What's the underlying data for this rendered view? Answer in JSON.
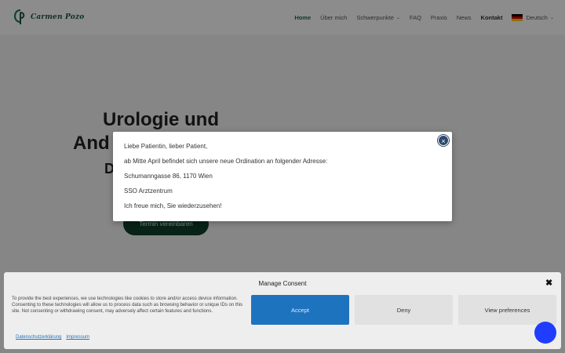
{
  "header": {
    "logo_text": "Carmen Pozo",
    "nav": [
      {
        "label": "Home"
      },
      {
        "label": "Über mich"
      },
      {
        "label": "Schwerpunkte"
      },
      {
        "label": "FAQ"
      },
      {
        "label": "Praxis"
      },
      {
        "label": "News"
      },
      {
        "label": "Kontakt"
      },
      {
        "label": "Deutsch"
      }
    ]
  },
  "hero": {
    "line1": "Urologie und",
    "line2": "And",
    "line3": "D",
    "button": "Termin vereinbaren"
  },
  "notice": {
    "greeting": "Liebe Patientin, lieber Patient,",
    "line1": "ab Mitte April befindet sich unsere neue Ordination an folgender Adresse:",
    "address": "Schumanngasse 86, 1170 Wien",
    "center": "SSO Arztzentrum",
    "closing": "Ich freue mich, Sie wiederzusehen!",
    "close_glyph": "×"
  },
  "consent": {
    "title": "Manage Consent",
    "close_glyph": "✖",
    "text": "To provide the best experiences, we use technologies like cookies to store and/or access device information. Consenting to these technologies will allow us to process data such as browsing behavior or unique IDs on this site. Not consenting or withdrawing consent, may adversely affect certain features and functions.",
    "accept": "Accept",
    "deny": "Deny",
    "preferences": "View preferences",
    "links": [
      "Datenschutzerklärung",
      "Impressum"
    ]
  },
  "colors": {
    "brand_green": "#1e6b45",
    "accept_blue": "#1e73be",
    "chat_blue": "#1f3cff"
  }
}
